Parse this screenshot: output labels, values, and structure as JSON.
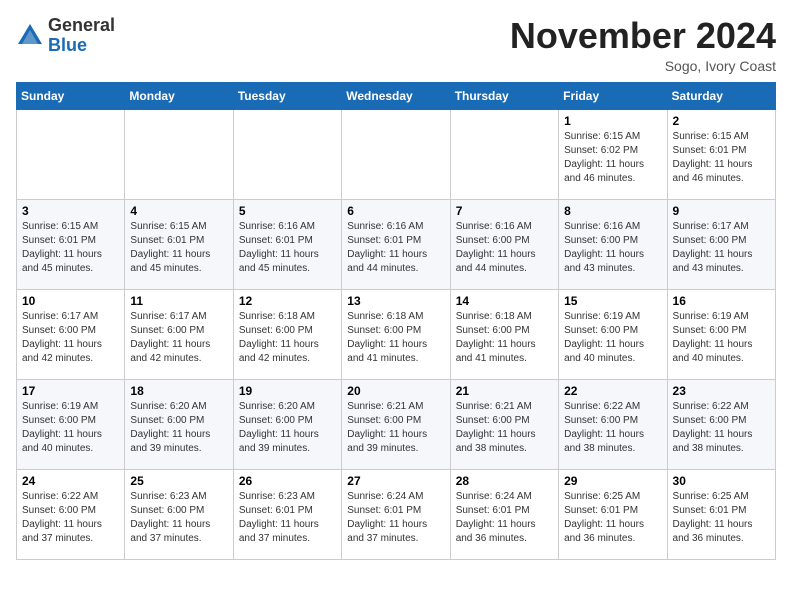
{
  "header": {
    "logo_general": "General",
    "logo_blue": "Blue",
    "month_title": "November 2024",
    "subtitle": "Sogo, Ivory Coast"
  },
  "weekdays": [
    "Sunday",
    "Monday",
    "Tuesday",
    "Wednesday",
    "Thursday",
    "Friday",
    "Saturday"
  ],
  "weeks": [
    [
      {
        "day": "",
        "info": ""
      },
      {
        "day": "",
        "info": ""
      },
      {
        "day": "",
        "info": ""
      },
      {
        "day": "",
        "info": ""
      },
      {
        "day": "",
        "info": ""
      },
      {
        "day": "1",
        "info": "Sunrise: 6:15 AM\nSunset: 6:02 PM\nDaylight: 11 hours and 46 minutes."
      },
      {
        "day": "2",
        "info": "Sunrise: 6:15 AM\nSunset: 6:01 PM\nDaylight: 11 hours and 46 minutes."
      }
    ],
    [
      {
        "day": "3",
        "info": "Sunrise: 6:15 AM\nSunset: 6:01 PM\nDaylight: 11 hours and 45 minutes."
      },
      {
        "day": "4",
        "info": "Sunrise: 6:15 AM\nSunset: 6:01 PM\nDaylight: 11 hours and 45 minutes."
      },
      {
        "day": "5",
        "info": "Sunrise: 6:16 AM\nSunset: 6:01 PM\nDaylight: 11 hours and 45 minutes."
      },
      {
        "day": "6",
        "info": "Sunrise: 6:16 AM\nSunset: 6:01 PM\nDaylight: 11 hours and 44 minutes."
      },
      {
        "day": "7",
        "info": "Sunrise: 6:16 AM\nSunset: 6:00 PM\nDaylight: 11 hours and 44 minutes."
      },
      {
        "day": "8",
        "info": "Sunrise: 6:16 AM\nSunset: 6:00 PM\nDaylight: 11 hours and 43 minutes."
      },
      {
        "day": "9",
        "info": "Sunrise: 6:17 AM\nSunset: 6:00 PM\nDaylight: 11 hours and 43 minutes."
      }
    ],
    [
      {
        "day": "10",
        "info": "Sunrise: 6:17 AM\nSunset: 6:00 PM\nDaylight: 11 hours and 42 minutes."
      },
      {
        "day": "11",
        "info": "Sunrise: 6:17 AM\nSunset: 6:00 PM\nDaylight: 11 hours and 42 minutes."
      },
      {
        "day": "12",
        "info": "Sunrise: 6:18 AM\nSunset: 6:00 PM\nDaylight: 11 hours and 42 minutes."
      },
      {
        "day": "13",
        "info": "Sunrise: 6:18 AM\nSunset: 6:00 PM\nDaylight: 11 hours and 41 minutes."
      },
      {
        "day": "14",
        "info": "Sunrise: 6:18 AM\nSunset: 6:00 PM\nDaylight: 11 hours and 41 minutes."
      },
      {
        "day": "15",
        "info": "Sunrise: 6:19 AM\nSunset: 6:00 PM\nDaylight: 11 hours and 40 minutes."
      },
      {
        "day": "16",
        "info": "Sunrise: 6:19 AM\nSunset: 6:00 PM\nDaylight: 11 hours and 40 minutes."
      }
    ],
    [
      {
        "day": "17",
        "info": "Sunrise: 6:19 AM\nSunset: 6:00 PM\nDaylight: 11 hours and 40 minutes."
      },
      {
        "day": "18",
        "info": "Sunrise: 6:20 AM\nSunset: 6:00 PM\nDaylight: 11 hours and 39 minutes."
      },
      {
        "day": "19",
        "info": "Sunrise: 6:20 AM\nSunset: 6:00 PM\nDaylight: 11 hours and 39 minutes."
      },
      {
        "day": "20",
        "info": "Sunrise: 6:21 AM\nSunset: 6:00 PM\nDaylight: 11 hours and 39 minutes."
      },
      {
        "day": "21",
        "info": "Sunrise: 6:21 AM\nSunset: 6:00 PM\nDaylight: 11 hours and 38 minutes."
      },
      {
        "day": "22",
        "info": "Sunrise: 6:22 AM\nSunset: 6:00 PM\nDaylight: 11 hours and 38 minutes."
      },
      {
        "day": "23",
        "info": "Sunrise: 6:22 AM\nSunset: 6:00 PM\nDaylight: 11 hours and 38 minutes."
      }
    ],
    [
      {
        "day": "24",
        "info": "Sunrise: 6:22 AM\nSunset: 6:00 PM\nDaylight: 11 hours and 37 minutes."
      },
      {
        "day": "25",
        "info": "Sunrise: 6:23 AM\nSunset: 6:00 PM\nDaylight: 11 hours and 37 minutes."
      },
      {
        "day": "26",
        "info": "Sunrise: 6:23 AM\nSunset: 6:01 PM\nDaylight: 11 hours and 37 minutes."
      },
      {
        "day": "27",
        "info": "Sunrise: 6:24 AM\nSunset: 6:01 PM\nDaylight: 11 hours and 37 minutes."
      },
      {
        "day": "28",
        "info": "Sunrise: 6:24 AM\nSunset: 6:01 PM\nDaylight: 11 hours and 36 minutes."
      },
      {
        "day": "29",
        "info": "Sunrise: 6:25 AM\nSunset: 6:01 PM\nDaylight: 11 hours and 36 minutes."
      },
      {
        "day": "30",
        "info": "Sunrise: 6:25 AM\nSunset: 6:01 PM\nDaylight: 11 hours and 36 minutes."
      }
    ]
  ]
}
